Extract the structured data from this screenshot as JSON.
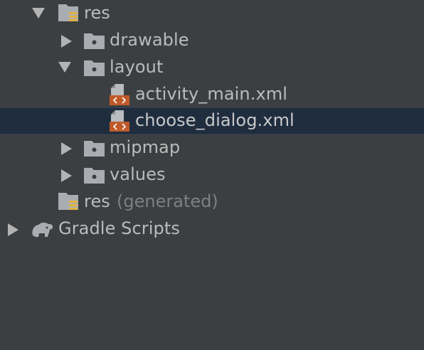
{
  "project_tree": {
    "res": {
      "label": "res",
      "icon": "resource-folder-icon"
    },
    "drawable": {
      "label": "drawable",
      "icon": "folder-icon"
    },
    "layout": {
      "label": "layout",
      "icon": "folder-icon"
    },
    "activity_main": {
      "label": "activity_main.xml",
      "icon": "layout-xml-file-icon"
    },
    "choose_dialog": {
      "label": "choose_dialog.xml",
      "icon": "layout-xml-file-icon"
    },
    "mipmap": {
      "label": "mipmap",
      "icon": "folder-icon"
    },
    "values": {
      "label": "values",
      "icon": "folder-icon"
    },
    "res_generated": {
      "label": "res",
      "suffix": "(generated)",
      "icon": "resource-folder-icon"
    },
    "gradle_scripts": {
      "label": "Gradle Scripts",
      "icon": "gradle-elephant-icon"
    }
  },
  "colors": {
    "background": "#3c3f41",
    "selection": "#1f2d3f",
    "text": "#bbbbbb",
    "muted_text": "#7f7f7f",
    "xml_icon_accent": "#c05a2a"
  }
}
